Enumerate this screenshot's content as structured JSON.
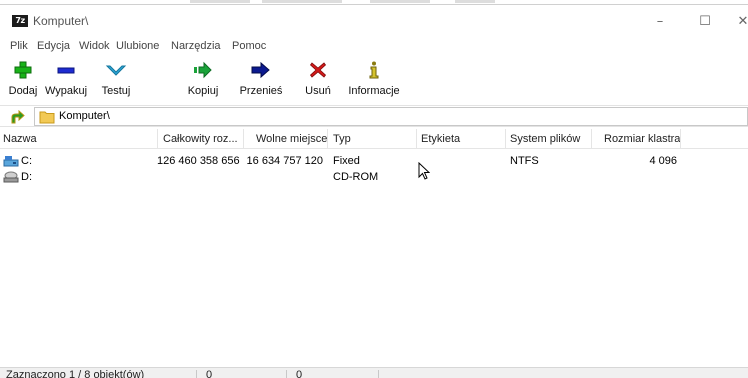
{
  "window": {
    "title": "Komputer\\",
    "app_icon_text": "7z",
    "min_glyph": "–",
    "max_glyph": "☐",
    "close_glyph": "✕"
  },
  "menu": [
    "Plik",
    "Edycja",
    "Widok",
    "Ulubione",
    "Narzędzia",
    "Pomoc"
  ],
  "toolbar": {
    "add": "Dodaj",
    "extract": "Wypakuj",
    "test": "Testuj",
    "copy": "Kopiuj",
    "move": "Przenieś",
    "delete": "Usuń",
    "info": "Informacje"
  },
  "address": {
    "path": "Komputer\\"
  },
  "columns": {
    "name": "Nazwa",
    "total": "Całkowity roz...",
    "free": "Wolne miejsce",
    "type": "Typ",
    "label": "Etykieta",
    "fs": "System plików",
    "cluster": "Rozmiar klastra"
  },
  "rows": [
    {
      "name": "C:",
      "total": "126 460 358 656",
      "free": "16 634 757 120",
      "type": "Fixed",
      "label": "",
      "fs": "NTFS",
      "cluster": "4 096"
    },
    {
      "name": "D:",
      "total": "",
      "free": "",
      "type": "CD-ROM",
      "label": "",
      "fs": "",
      "cluster": ""
    }
  ],
  "status": {
    "selected": "Zaznaczono 1 / 8 obiekt(ów)",
    "size1": "0",
    "size2": "0"
  },
  "icons": {
    "add": "plus-icon",
    "extract": "minus-icon",
    "test": "check-chevron-icon",
    "copy": "copy-arrow-icon",
    "move": "move-arrow-icon",
    "delete": "x-delete-icon",
    "info": "info-icon",
    "up": "up-folder-icon",
    "folder": "folder-icon",
    "drive_c": "hard-drive-icon",
    "drive_d": "cd-drive-icon"
  },
  "colors": {
    "add": "#19b319",
    "extract": "#1d2bd1",
    "test": "#2fa7d8",
    "copy": "#1aa33a",
    "move": "#0c1a8f",
    "delete": "#d11a1a",
    "info": "#8a7a10"
  }
}
